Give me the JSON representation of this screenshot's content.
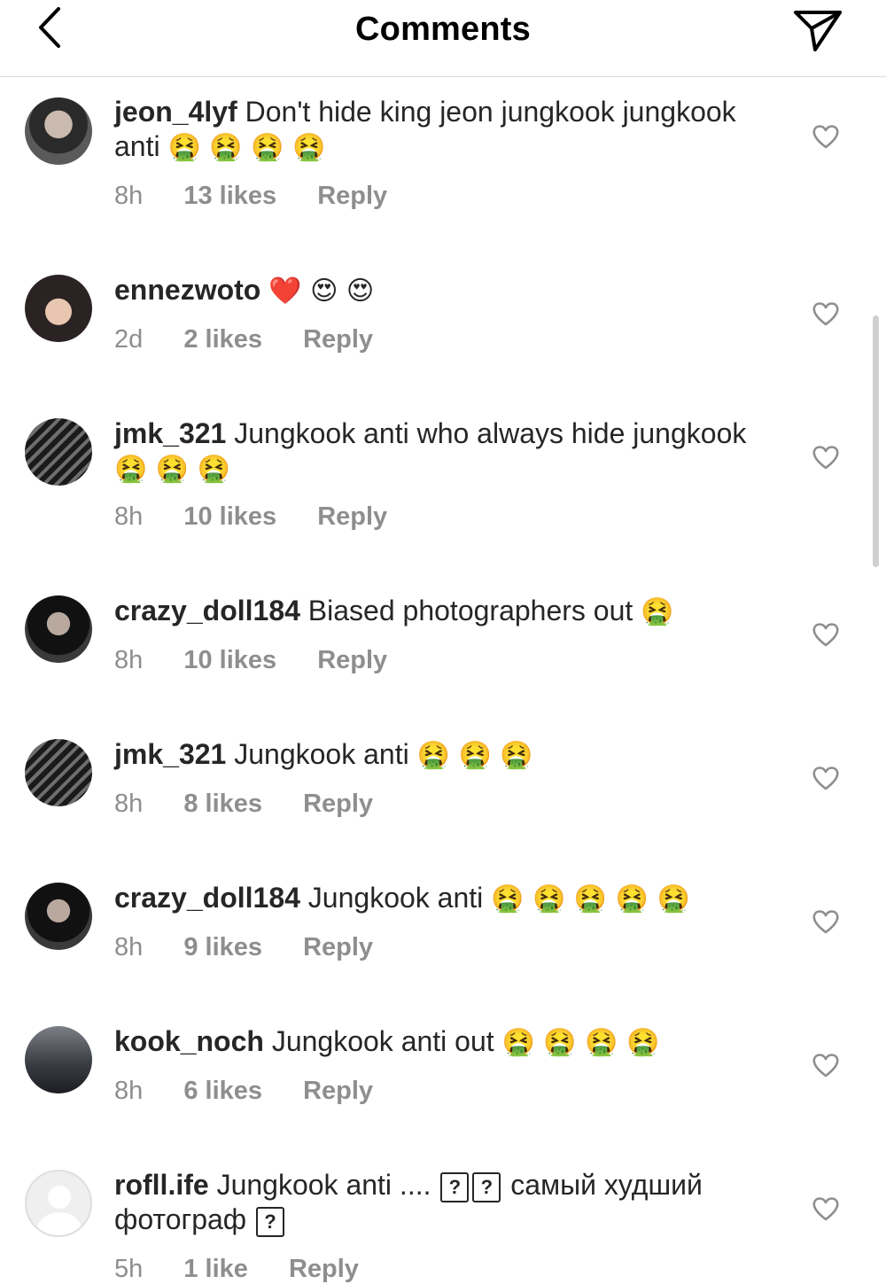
{
  "header": {
    "title": "Comments",
    "back_icon": "chevron-left-icon",
    "send_icon": "paper-plane-icon"
  },
  "comments": [
    {
      "username": "jeon_4lyf",
      "text": "Don't hide king jeon jungkook jungkook anti",
      "emoji": "🤮 🤮 🤮 🤮",
      "time": "8h",
      "likes": "13 likes",
      "reply": "Reply"
    },
    {
      "username": "ennezwoto",
      "text": "",
      "emoji": "❤️ 😍 😍",
      "time": "2d",
      "likes": "2 likes",
      "reply": "Reply"
    },
    {
      "username": "jmk_321",
      "text": "Jungkook anti who always hide jungkook",
      "emoji": "🤮 🤮 🤮",
      "time": "8h",
      "likes": "10 likes",
      "reply": "Reply"
    },
    {
      "username": "crazy_doll184",
      "text": "Biased photographers out",
      "emoji": "🤮",
      "time": "8h",
      "likes": "10 likes",
      "reply": "Reply"
    },
    {
      "username": "jmk_321",
      "text": "Jungkook anti",
      "emoji": "🤮 🤮 🤮",
      "time": "8h",
      "likes": "8 likes",
      "reply": "Reply"
    },
    {
      "username": "crazy_doll184",
      "text": "Jungkook anti",
      "emoji": "🤮 🤮 🤮 🤮 🤮",
      "time": "8h",
      "likes": "9 likes",
      "reply": "Reply"
    },
    {
      "username": "kook_noch",
      "text": "Jungkook anti out",
      "emoji": "🤮 🤮 🤮 🤮",
      "time": "8h",
      "likes": "6 likes",
      "reply": "Reply"
    },
    {
      "username": "rofll.ife",
      "text_a": "Jungkook anti ....",
      "box": "?",
      "text_b": "самый худший фотограф",
      "time": "5h",
      "likes": "1 like",
      "reply": "Reply"
    }
  ]
}
